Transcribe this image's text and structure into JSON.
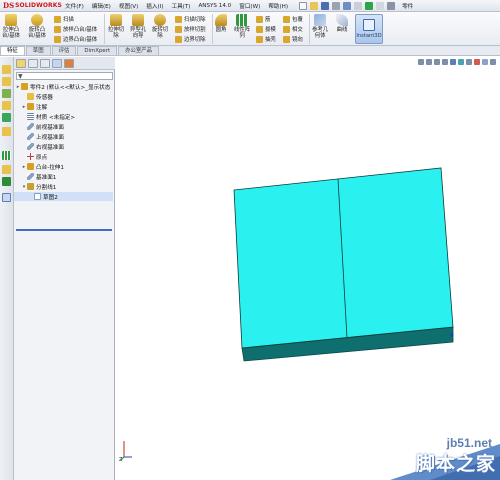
{
  "app": {
    "logo_ds": "DS",
    "logo_name": "SOLIDWORKS",
    "doc_title": "零件"
  },
  "menu": [
    {
      "label": "文件(F)"
    },
    {
      "label": "编辑(E)"
    },
    {
      "label": "视图(V)"
    },
    {
      "label": "插入(I)"
    },
    {
      "label": "工具(T)"
    },
    {
      "label": "ANSYS 14.0"
    },
    {
      "label": "窗口(W)"
    },
    {
      "label": "帮助(H)"
    }
  ],
  "toolbar": {
    "boss_extrude": "拉伸凸\n台/基体",
    "boss_revolve": "旋转凸\n台/基体",
    "sweep": "扫描",
    "loft": "放样凸台/基体",
    "boundary_boss": "边界凸台/基体",
    "cut_extrude": "拉伸切\n除",
    "hole_wizard": "异型孔\n向导",
    "cut_revolve": "旋转切\n除",
    "cut_sweep": "扫描切除",
    "cut_loft": "放样切割",
    "cut_boundary": "边界切除",
    "fillet": "圆角",
    "linear_pattern": "线性阵\n列",
    "rib": "筋",
    "draft": "拔模",
    "shell": "抽壳",
    "wrap": "包覆",
    "intersect": "相交",
    "mirror": "镜向",
    "reference_geometry": "参考几\n何体",
    "curves": "曲线",
    "instant3d": "Instant3D"
  },
  "tabs": [
    {
      "label": "特征",
      "active": true
    },
    {
      "label": "草图",
      "active": false
    },
    {
      "label": "评估",
      "active": false
    },
    {
      "label": "DimXpert",
      "active": false
    },
    {
      "label": "办公室产品",
      "active": false
    }
  ],
  "tree": [
    {
      "label": "零件2 (默认<<默认>_显示状态",
      "toggle": "▸",
      "icon_color": "#d8a020",
      "indent": 0
    },
    {
      "label": "传感器",
      "toggle": "",
      "icon_color": "#e8c040",
      "indent": 1
    },
    {
      "label": "注解",
      "toggle": "▸",
      "icon_color": "#d8a020",
      "indent": 1
    },
    {
      "label": "材质 <未指定>",
      "toggle": "",
      "icon_color": "#7080a0",
      "indent": 1
    },
    {
      "label": "前视基准面",
      "toggle": "",
      "icon_color": "#8aa0c0",
      "indent": 1
    },
    {
      "label": "上视基准面",
      "toggle": "",
      "icon_color": "#8aa0c0",
      "indent": 1
    },
    {
      "label": "右视基准面",
      "toggle": "",
      "icon_color": "#8aa0c0",
      "indent": 1
    },
    {
      "label": "原点",
      "toggle": "",
      "icon_color": "#c04040",
      "indent": 1
    },
    {
      "label": "凸台-拉伸1",
      "toggle": "▸",
      "icon_color": "#d8a020",
      "indent": 1
    },
    {
      "label": "基准面1",
      "toggle": "",
      "icon_color": "#8aa0c0",
      "indent": 1
    },
    {
      "label": "分割线1",
      "toggle": "▾",
      "icon_color": "#c8a030",
      "indent": 1
    },
    {
      "label": "草图2",
      "toggle": "",
      "icon_color": "#7f9fd0",
      "indent": 2,
      "selected": true
    }
  ],
  "graphics": {
    "part_face_color": "#2bf0f0",
    "part_side_color": "#0f6e6e",
    "triad_label": "Z"
  },
  "watermark": {
    "url": "jb51.net",
    "name": "脚本之家"
  }
}
